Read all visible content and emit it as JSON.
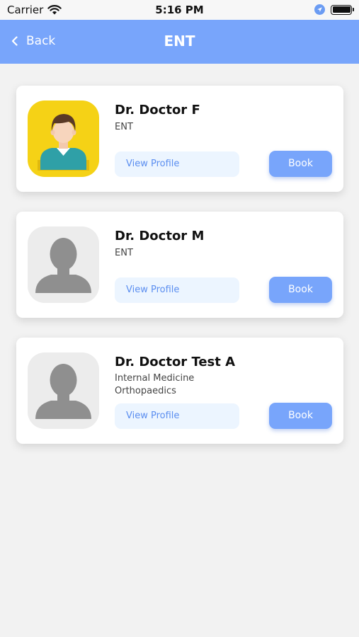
{
  "status_bar": {
    "carrier": "Carrier",
    "time": "5:16 PM"
  },
  "nav": {
    "back_label": "Back",
    "title": "ENT"
  },
  "doctors": [
    {
      "name": "Dr. Doctor F",
      "specialties": [
        "ENT"
      ],
      "view_profile_label": "View Profile",
      "book_label": "Book"
    },
    {
      "name": "Dr. Doctor M",
      "specialties": [
        "ENT"
      ],
      "view_profile_label": "View Profile",
      "book_label": "Book"
    },
    {
      "name": "Dr. Doctor Test A",
      "specialties": [
        "Internal Medicine",
        "Orthopaedics"
      ],
      "view_profile_label": "View Profile",
      "book_label": "Book"
    }
  ],
  "colors": {
    "primary": "#78a5fb",
    "avatar_yellow": "#f5d216",
    "view_profile_bg": "#ecf5ff",
    "background": "#f2f2f2"
  },
  "icons": {
    "wifi": "wifi-icon",
    "location": "location-arrow-icon",
    "battery": "battery-icon",
    "back": "chevron-left-icon"
  }
}
